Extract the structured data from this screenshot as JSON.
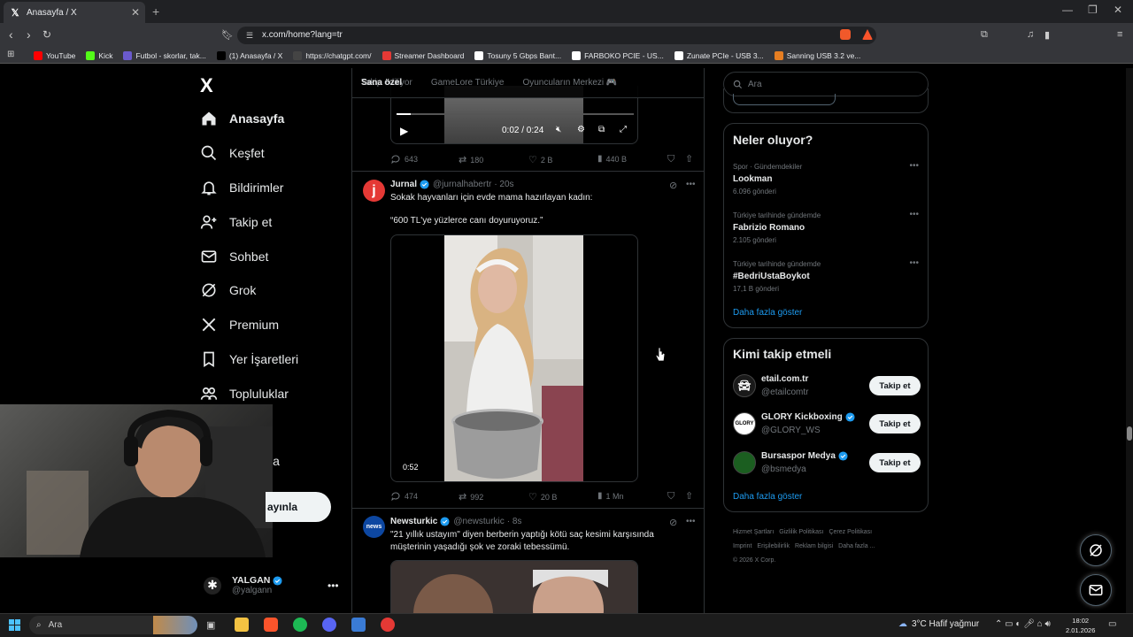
{
  "browser": {
    "tab_title": "Anasayfa / X",
    "url": "x.com/home?lang=tr",
    "bookmarks": [
      {
        "label": "YouTube",
        "color": "#ff0000"
      },
      {
        "label": "Kick",
        "color": "#53fc18"
      },
      {
        "label": "Futbol - skorlar, tak...",
        "color": "#6a5acd"
      },
      {
        "label": "(1) Anasayfa / X",
        "color": "#000000"
      },
      {
        "label": "https://chatgpt.com/",
        "color": "#444444"
      },
      {
        "label": "Streamer Dashboard",
        "color": "#e53935"
      },
      {
        "label": "Tosuny 5 Gbps Bant...",
        "color": "#ffffff"
      },
      {
        "label": "FARBOKO PCIE - US...",
        "color": "#ffffff"
      },
      {
        "label": "Zunate PCIe - USB 3...",
        "color": "#ffffff"
      },
      {
        "label": "Sanning USB 3.2 ve...",
        "color": "#e67e22"
      }
    ]
  },
  "sidebar": {
    "logo": "X",
    "items": [
      {
        "label": "Anasayfa",
        "icon": "home-icon"
      },
      {
        "label": "Keşfet",
        "icon": "search-icon"
      },
      {
        "label": "Bildirimler",
        "icon": "bell-icon"
      },
      {
        "label": "Takip et",
        "icon": "person-plus-icon"
      },
      {
        "label": "Sohbet",
        "icon": "mail-icon"
      },
      {
        "label": "Grok",
        "icon": "grok-icon"
      },
      {
        "label": "Premium",
        "icon": "x-icon"
      },
      {
        "label": "Yer İşaretleri",
        "icon": "bookmark-icon"
      },
      {
        "label": "Topluluklar",
        "icon": "people-icon"
      },
      {
        "label": "zla",
        "icon": ""
      }
    ],
    "post_button": "ayınla",
    "profile": {
      "name": "YALGAN",
      "handle": "@yalgann"
    }
  },
  "timeline": {
    "tabs": [
      "Sana özel",
      "Takip ediliyor",
      "GameLore Türkiye",
      "Oyuncuların Merkezi 🎮"
    ],
    "top_video": {
      "time": "0:02 / 0:24"
    },
    "top_actions": {
      "replies": "643",
      "reposts": "180",
      "likes": "2 B",
      "views": "440 B"
    },
    "tweets": [
      {
        "name": "Jurnal",
        "handle": "@jurnalhabertr",
        "time": "· 20s",
        "avatar_letter": "j",
        "avatar_color": "#e53935",
        "text1": "Sokak hayvanları için evde mama hazırlayan kadın:",
        "text2": "“600 TL'ye yüzlerce canı doyuruyoruz.”",
        "duration": "0:52",
        "replies": "474",
        "reposts": "992",
        "likes": "20 B",
        "views": "1 Mn"
      },
      {
        "name": "Newsturkic",
        "handle": "@newsturkic",
        "time": "· 8s",
        "avatar_letter": "news",
        "avatar_color": "#0d47a1",
        "text1": "\"21 yıllık ustayım\" diyen berberin yaptığı kötü saç kesimi karşısında müşterinin yaşadığı şok ve zoraki tebessümü."
      }
    ]
  },
  "right": {
    "search_placeholder": "Ara",
    "trends_title": "Neler oluyor?",
    "trends": [
      {
        "context": "Spor · Gündemdekiler",
        "name": "Lookman",
        "posts": "6.096 gönderi"
      },
      {
        "context": "Türkiye tarihinde gündemde",
        "name": "Fabrizio Romano",
        "posts": "2.105 gönderi"
      },
      {
        "context": "Türkiye tarihinde gündemde",
        "name": "#BedriUstaBoykot",
        "posts": "17,1 B gönderi"
      }
    ],
    "trends_more": "Daha fazla göster",
    "who_title": "Kimi takip etmeli",
    "who": [
      {
        "name": "etail.com.tr",
        "handle": "@etailcomtr",
        "verified": false,
        "avatar_text": "",
        "avatar_color": "#1a1a1a"
      },
      {
        "name": "GLORY Kickboxing",
        "handle": "@GLORY_WS",
        "verified": true,
        "avatar_text": "GLORY",
        "avatar_color": "#ffffff"
      },
      {
        "name": "Bursaspor Medya",
        "handle": "@bsmedya",
        "verified": true,
        "avatar_text": "",
        "avatar_color": "#1b5e20"
      }
    ],
    "follow_label": "Takip et",
    "who_more": "Daha fazla göster",
    "footer": [
      "Hizmet Şartları",
      "Gizlilik Politikası",
      "Çerez Politikası",
      "Imprint",
      "Erişilebilirlik",
      "Reklam bilgisi",
      "Daha fazla ...",
      "© 2026 X Corp."
    ]
  },
  "taskbar": {
    "search": "Ara",
    "weather": "3°C  Hafif yağmur",
    "time": "18:02",
    "date": "2.01.2026"
  }
}
